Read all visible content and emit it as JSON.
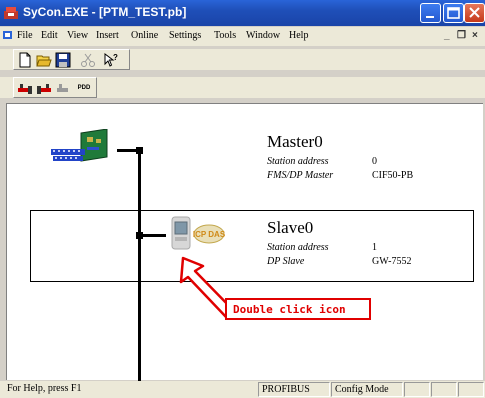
{
  "window": {
    "title": "SyCon.EXE - [PTM_TEST.pb]",
    "min_symbol": "–",
    "max_symbol": "□",
    "close_symbol": "✕"
  },
  "menubar": {
    "items": [
      "File",
      "Edit",
      "View",
      "Insert",
      "Online",
      "Settings",
      "Tools",
      "Window",
      "Help"
    ],
    "mdi_min": "_",
    "mdi_restore": "❐",
    "mdi_close": "×"
  },
  "toolbar2": {
    "pdd_label": "PDD"
  },
  "master": {
    "name": "Master0",
    "station_label": "Station address",
    "station_value": "0",
    "type_label": "FMS/DP Master",
    "type_value": "CIF50-PB"
  },
  "slave": {
    "name": "Slave0",
    "station_label": "Station address",
    "station_value": "1",
    "type_label": "DP Slave",
    "type_value": "GW-7552",
    "badge_text": "ICP DAS"
  },
  "annotation": {
    "text": "Double click icon",
    "color": "#e00000"
  },
  "statusbar": {
    "help": "For Help, press F1",
    "protocol": "PROFIBUS",
    "mode": "Config Mode"
  }
}
